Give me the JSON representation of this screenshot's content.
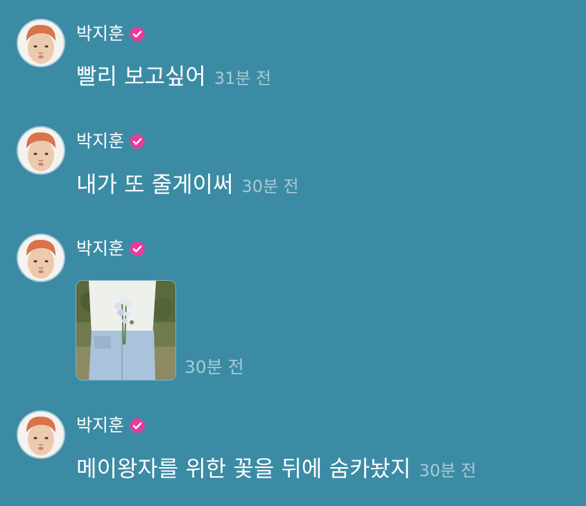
{
  "messages": [
    {
      "author": "박지훈",
      "text": "빨리 보고싶어",
      "time": "31분 전"
    },
    {
      "author": "박지훈",
      "text": "내가 또 줄게이써",
      "time": "30분 전"
    },
    {
      "author": "박지훈",
      "text": "",
      "time": "30분 전",
      "attachment": "photo"
    },
    {
      "author": "박지훈",
      "text": "메이왕자를 위한 꽃을 뒤에 숨카놨지",
      "time": "30분 전"
    }
  ],
  "colors": {
    "background": "#3c8ba5",
    "verified_badge": "#e73c9e",
    "text": "#ffffff"
  },
  "icons": {
    "verified": "verified-badge-icon"
  }
}
